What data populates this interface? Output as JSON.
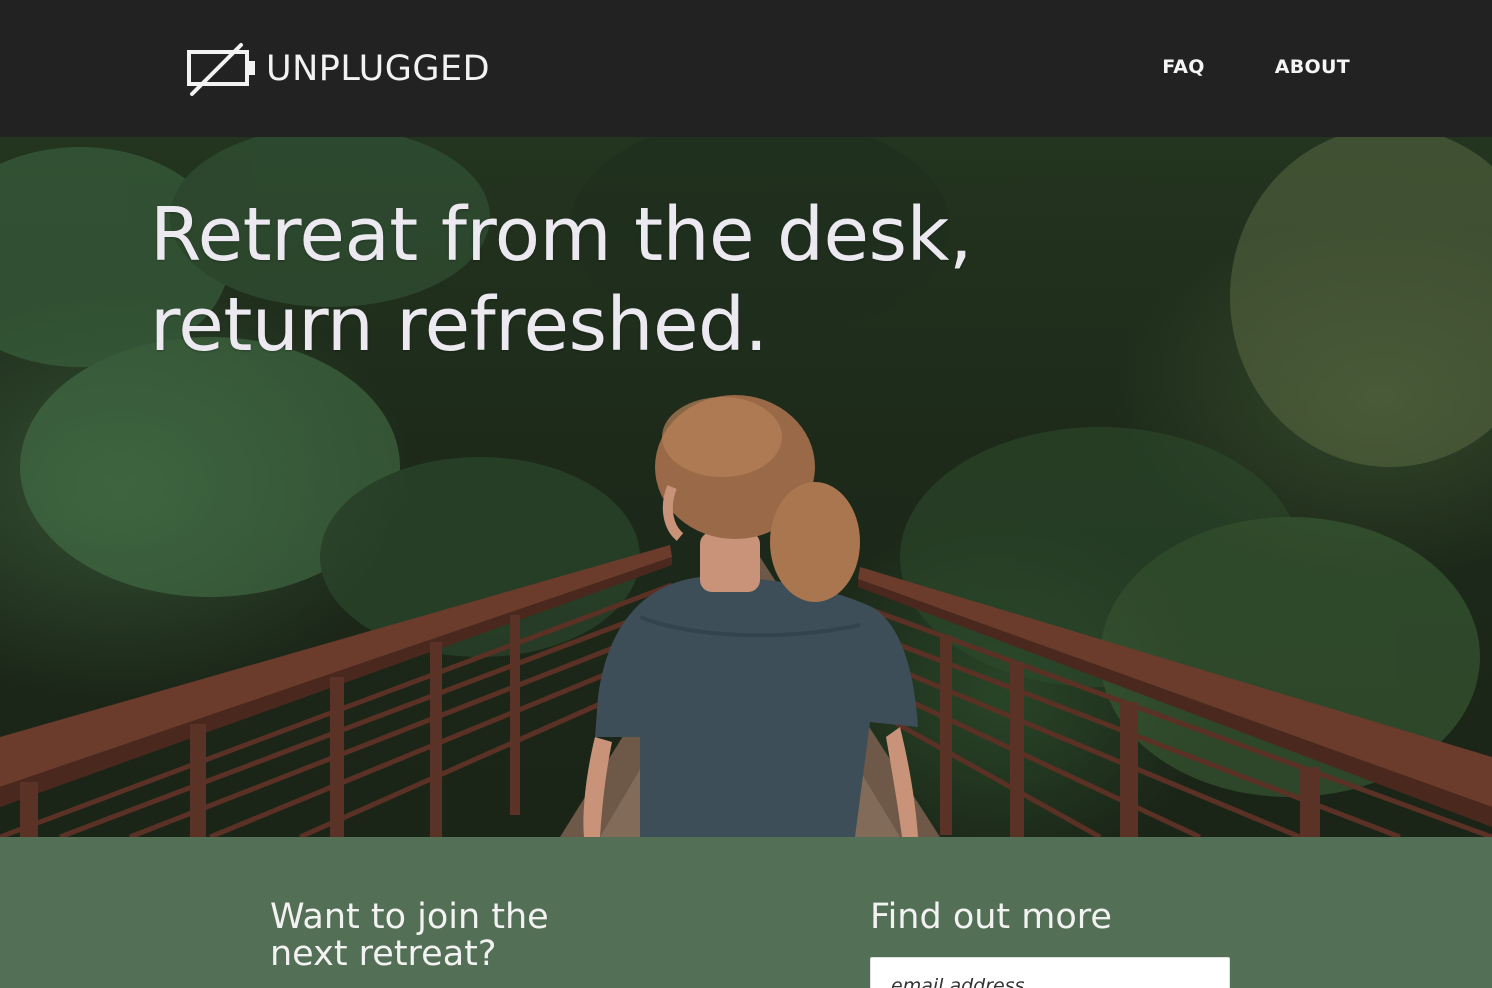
{
  "header": {
    "logo_text": "UNPLUGGED",
    "logo_icon": "unplugged-battery-icon",
    "nav": [
      {
        "label": "FAQ"
      },
      {
        "label": "ABOUT"
      }
    ]
  },
  "hero": {
    "headline_line1": "Retreat from the desk,",
    "headline_line2": "return refreshed."
  },
  "signup": {
    "join_line1": "Want to join the",
    "join_line2": "next retreat?",
    "more_heading": "Find out more",
    "email_placeholder": "email address"
  },
  "colors": {
    "header_bg": "#222222",
    "band_bg": "#536f55",
    "text_light": "#eceaf0"
  }
}
